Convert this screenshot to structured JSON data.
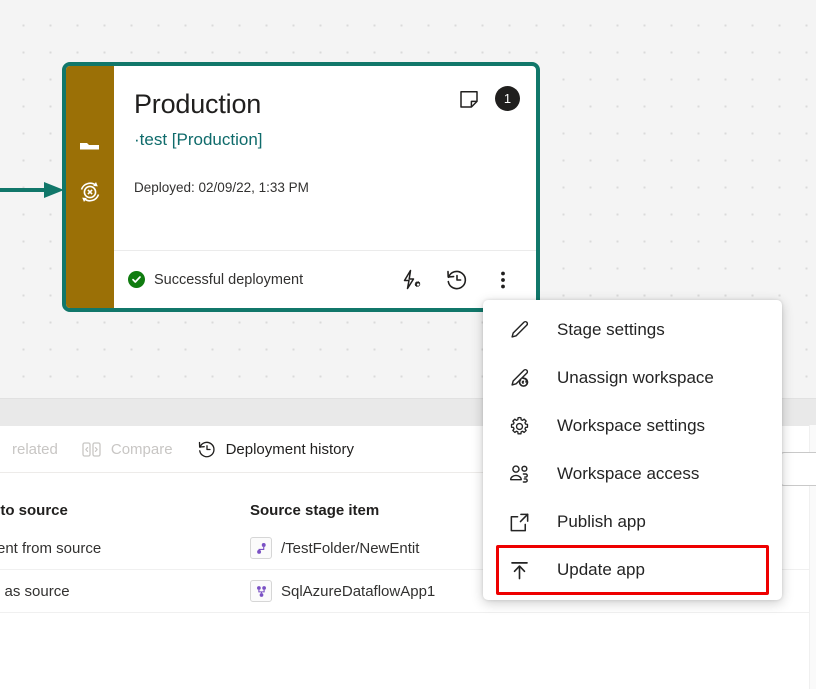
{
  "canvas": {
    "arrow_color": "#11776a"
  },
  "stage_card": {
    "border_color": "#11776a",
    "rail_color": "#9b7006",
    "title": "Production",
    "subtitle": "·test [Production]",
    "deployed_label": "Deployed: 02/09/22, 1:33 PM",
    "badge_count": "1",
    "note_icon": "sticky-note-icon",
    "rail_icons": [
      "workspace-icon",
      "sync-blocked-icon"
    ],
    "status": {
      "text": "Successful deployment",
      "color": "#107c10",
      "icon": "success-check-icon"
    },
    "footer_actions": [
      {
        "name": "deployment-rules-icon",
        "label": "Deployment rules"
      },
      {
        "name": "deployment-history-icon",
        "label": "Deployment history"
      },
      {
        "name": "more-options-icon",
        "label": "More options"
      }
    ]
  },
  "panel": {
    "command_bar": [
      {
        "label": "related",
        "icon": "",
        "state": "disabled"
      },
      {
        "label": "Compare",
        "icon": "compare-icon",
        "state": "disabled"
      },
      {
        "label": "Deployment history",
        "icon": "history-icon",
        "state": "active"
      }
    ],
    "table": {
      "headers": [
        "l to source",
        "Source stage item"
      ],
      "rows": [
        {
          "col1": "rent from source",
          "col2": "/TestFolder/NewEntit",
          "icon": "dataflow-item-icon"
        },
        {
          "col1": "e as source",
          "col2": "SqlAzureDataflowApp1",
          "icon": "dataflow-item-icon"
        }
      ]
    },
    "search_box": {
      "name": "search-input",
      "value": "",
      "placeholder": ""
    }
  },
  "context_menu": {
    "items": [
      {
        "label": "Stage settings",
        "icon": "pencil-icon",
        "highlighted": false
      },
      {
        "label": "Unassign workspace",
        "icon": "pencil-undo-icon",
        "highlighted": false
      },
      {
        "label": "Workspace settings",
        "icon": "gear-icon",
        "highlighted": false
      },
      {
        "label": "Workspace access",
        "icon": "people-icon",
        "highlighted": false
      },
      {
        "label": "Publish app",
        "icon": "open-external-icon",
        "highlighted": false
      },
      {
        "label": "Update app",
        "icon": "upload-icon",
        "highlighted": true
      }
    ],
    "highlight_color": "#ee0000"
  }
}
